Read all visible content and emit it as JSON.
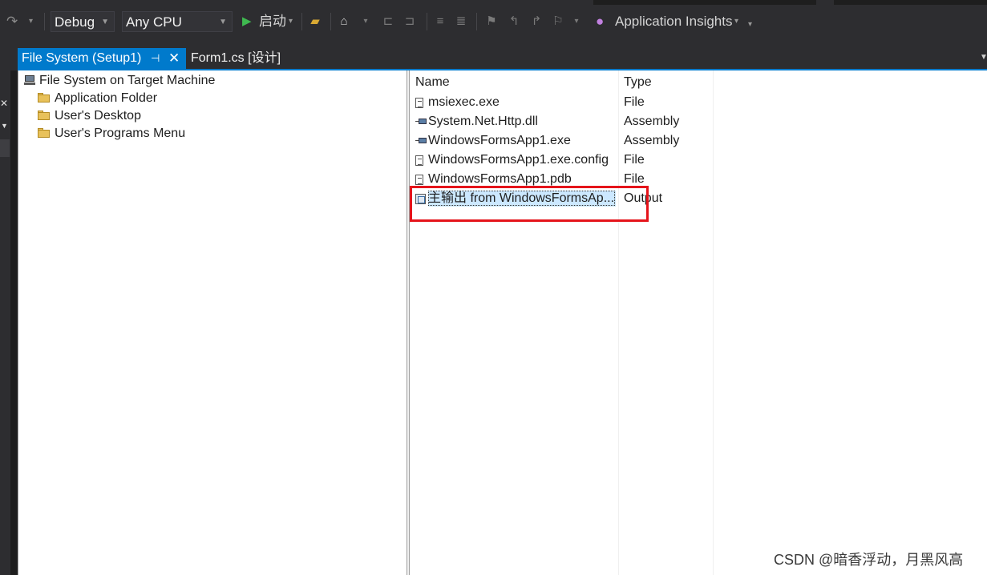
{
  "toolbar": {
    "config": "Debug",
    "platform": "Any CPU",
    "start_label": "启动",
    "insights_label": "Application Insights"
  },
  "tabs": [
    {
      "label": "File System (Setup1)",
      "active": true
    },
    {
      "label": "Form1.cs [设计]",
      "active": false
    }
  ],
  "tree": {
    "root": "File System on Target Machine",
    "folders": [
      "Application Folder",
      "User's Desktop",
      "User's Programs Menu"
    ]
  },
  "list": {
    "headers": {
      "name": "Name",
      "type": "Type"
    },
    "rows": [
      {
        "name": "msiexec.exe",
        "type": "File",
        "icon": "file-icon"
      },
      {
        "name": "System.Net.Http.dll",
        "type": "Assembly",
        "icon": "assembly-icon"
      },
      {
        "name": "WindowsFormsApp1.exe",
        "type": "Assembly",
        "icon": "assembly-icon"
      },
      {
        "name": "WindowsFormsApp1.exe.config",
        "type": "File",
        "icon": "file-icon"
      },
      {
        "name": "WindowsFormsApp1.pdb",
        "type": "File",
        "icon": "file-icon"
      },
      {
        "name": "主输出 from WindowsFormsAp...",
        "type": "Output",
        "icon": "output-icon",
        "selected": true
      }
    ]
  },
  "highlight_color": "#e5141b",
  "accent_color": "#007acc",
  "watermark": "CSDN @暗香浮动，月黑风高"
}
